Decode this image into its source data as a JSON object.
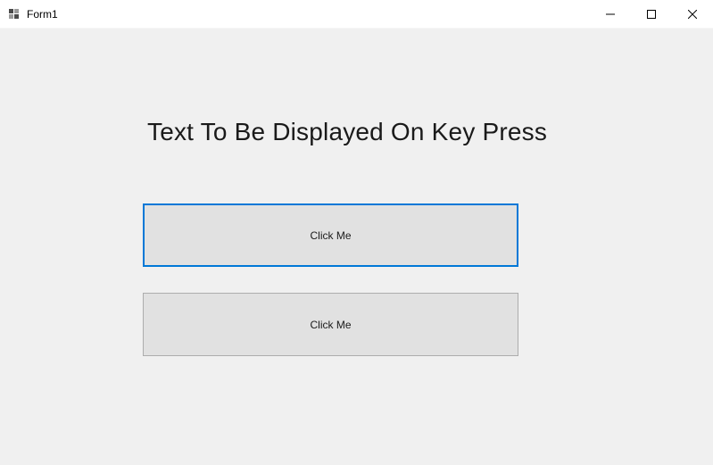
{
  "window": {
    "title": "Form1"
  },
  "content": {
    "label_text": "Text To Be Displayed On Key Press",
    "button1_label": "Click Me",
    "button2_label": "Click Me"
  }
}
